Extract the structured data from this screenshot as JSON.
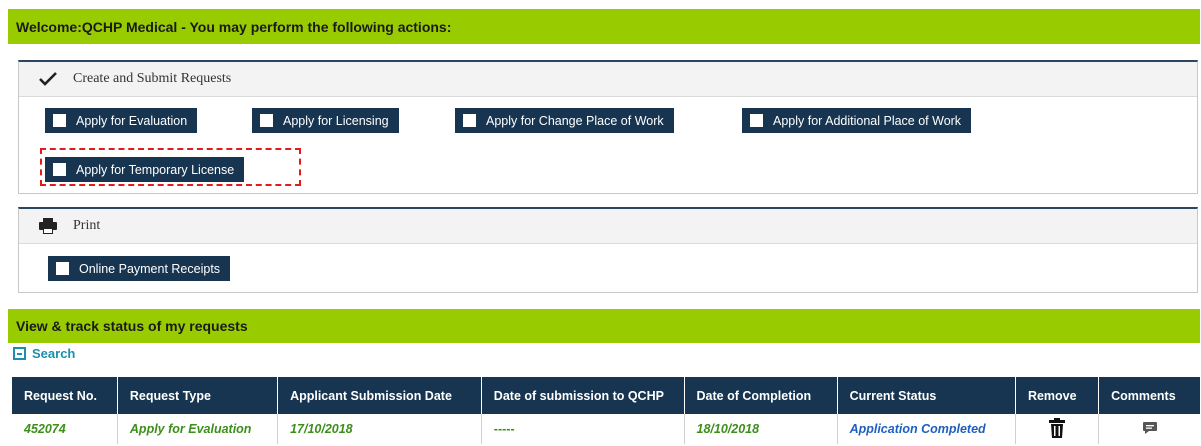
{
  "welcome_text": "Welcome:QCHP Medical - You may perform the following actions:",
  "create_panel": {
    "title": "Create and Submit Requests",
    "icon": "checkmark-icon",
    "buttons": [
      "Apply for Evaluation",
      "Apply for Licensing",
      "Apply for Change Place of Work",
      "Apply for Additional Place of Work",
      "Apply for Temporary License"
    ]
  },
  "print_panel": {
    "title": "Print",
    "icon": "printer-icon",
    "buttons": [
      "Online Payment Receipts"
    ]
  },
  "track_title": "View & track status of my requests",
  "search_label": "Search",
  "table": {
    "headers": [
      "Request No.",
      "Request Type",
      "Applicant Submission Date",
      "Date of submission to QCHP",
      "Date of Completion",
      "Current Status",
      "Remove",
      "Comments"
    ],
    "rows": [
      {
        "request_no": "452074",
        "request_type": "Apply for Evaluation",
        "applicant_submission_date": "17/10/2018",
        "submission_to_qchp": "-----",
        "completion_date": "18/10/2018",
        "status": "Application Completed",
        "remove_icon": "trash-icon",
        "comments_icon": "comment-icon"
      }
    ]
  },
  "colors": {
    "green_bar": "#99cc00",
    "navy": "#173550",
    "highlight": "#e21b1b",
    "status_blue": "#1f5fbf",
    "value_green": "#3d8f1c"
  }
}
